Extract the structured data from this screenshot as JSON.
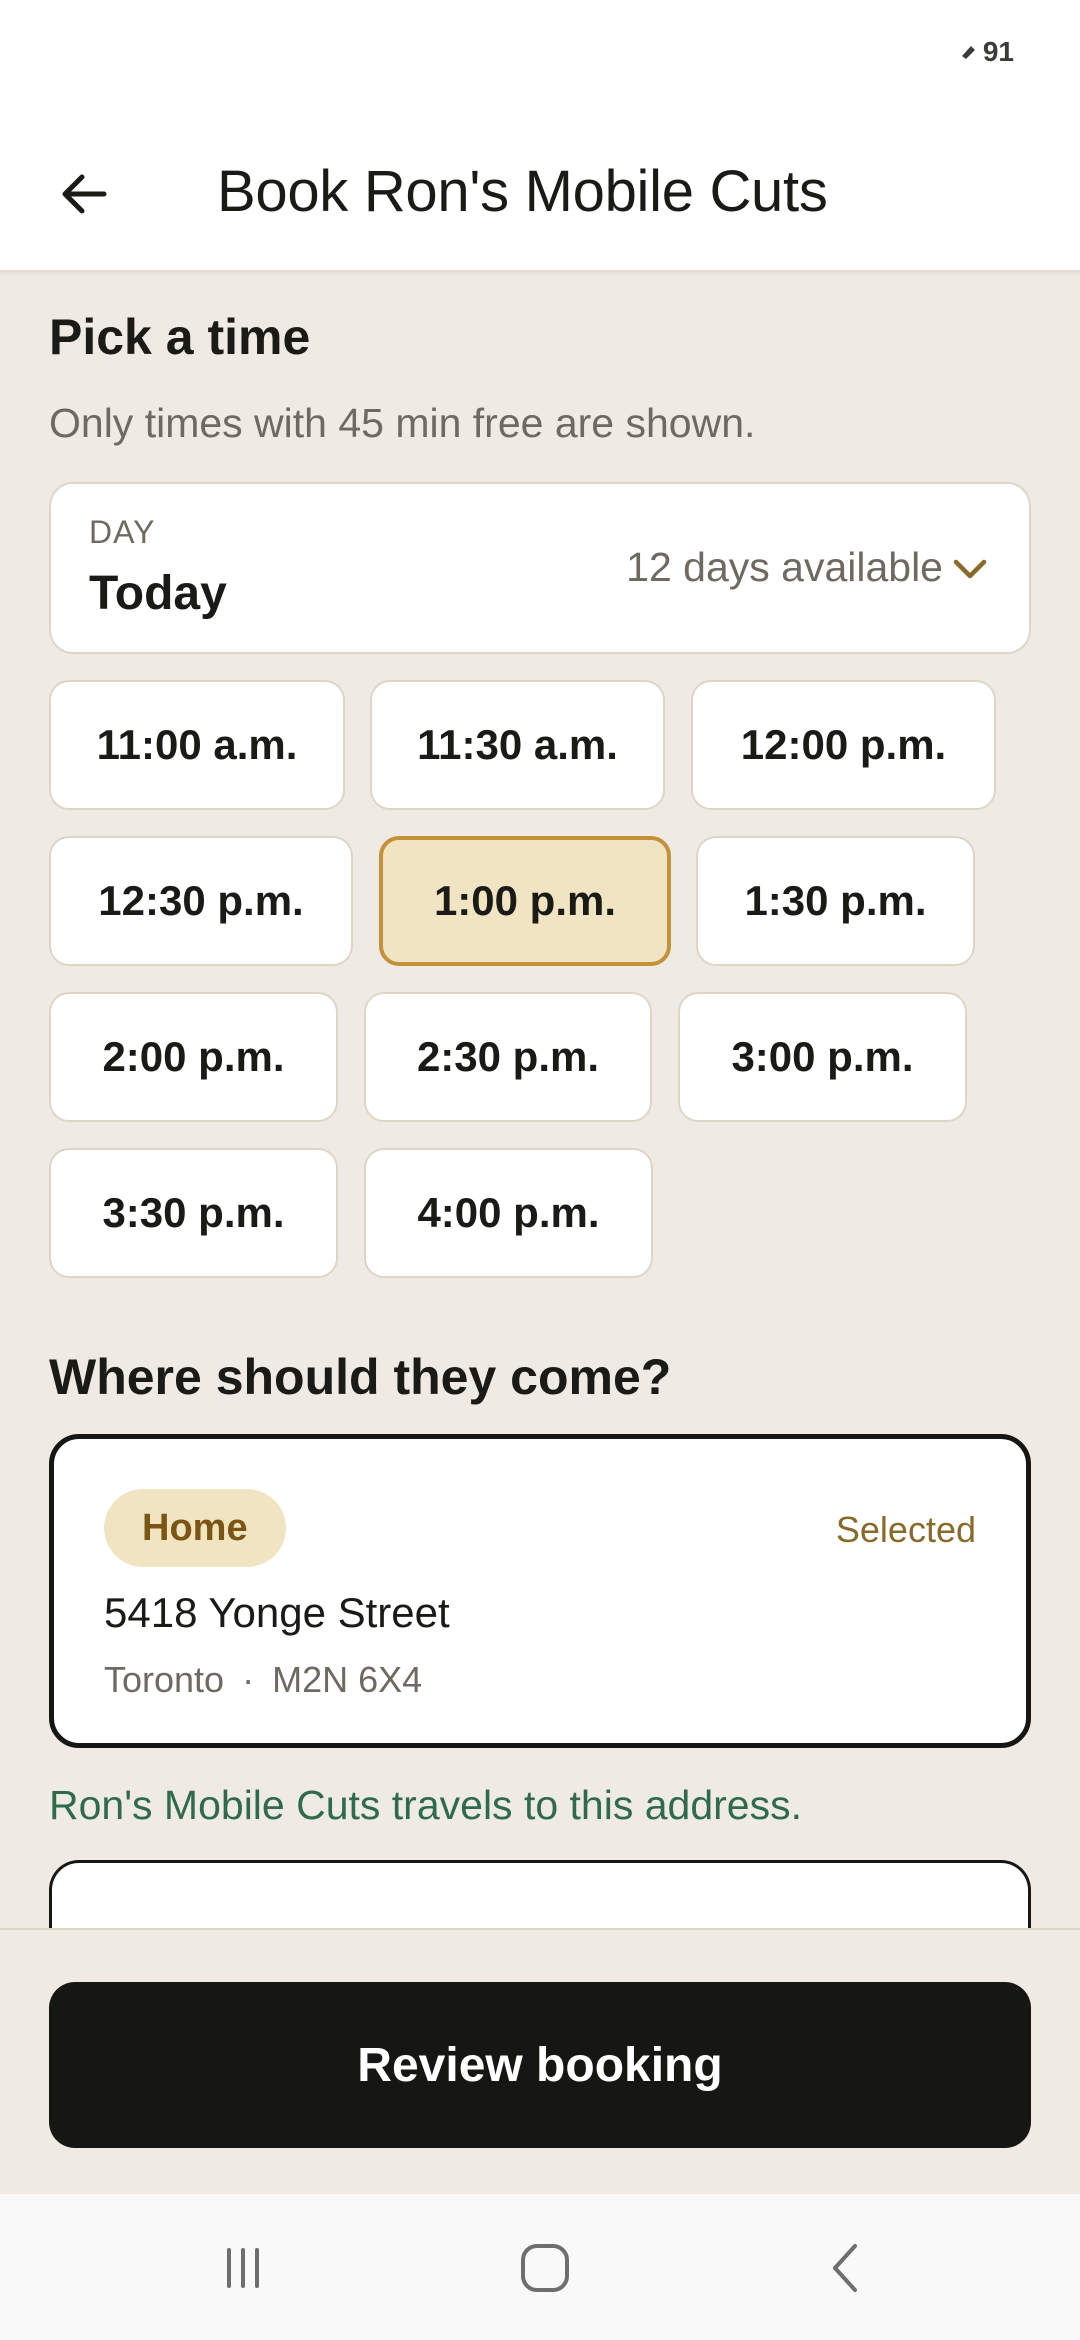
{
  "status_bar": {
    "battery": "91"
  },
  "app_bar": {
    "title": "Book Ron's Mobile Cuts"
  },
  "time_section": {
    "heading": "Pick a time",
    "note": "Only times with 45 min free are shown.",
    "day_picker": {
      "label": "DAY",
      "value": "Today",
      "availability": "12 days available"
    },
    "slots": [
      {
        "label": "11:00 a.m.",
        "selected": false
      },
      {
        "label": "11:30 a.m.",
        "selected": false
      },
      {
        "label": "12:00 p.m.",
        "selected": false
      },
      {
        "label": "12:30 p.m.",
        "selected": false
      },
      {
        "label": "1:00 p.m.",
        "selected": true
      },
      {
        "label": "1:30 p.m.",
        "selected": false
      },
      {
        "label": "2:00 p.m.",
        "selected": false
      },
      {
        "label": "2:30 p.m.",
        "selected": false
      },
      {
        "label": "3:00 p.m.",
        "selected": false
      },
      {
        "label": "3:30 p.m.",
        "selected": false
      },
      {
        "label": "4:00 p.m.",
        "selected": false
      }
    ]
  },
  "location_section": {
    "heading": "Where should they come?",
    "address": {
      "badge": "Home",
      "status": "Selected",
      "street": "5418 Yonge Street",
      "city": "Toronto",
      "separator": "·",
      "postal": "M2N 6X4"
    },
    "travel_note": "Ron's Mobile Cuts travels to this address."
  },
  "actions": {
    "review_label": "Review booking"
  },
  "colors": {
    "background": "#efebe4",
    "accent": "#c4913a",
    "selected_fill": "#f1e4c2",
    "primary_button": "#161613",
    "success_text": "#2f6b4a"
  },
  "icons": {
    "back": "arrow-left-icon",
    "day_picker": "chevron-down-icon",
    "nav_recents": "recents-icon",
    "nav_home": "home-icon",
    "nav_back": "nav-back-icon"
  }
}
